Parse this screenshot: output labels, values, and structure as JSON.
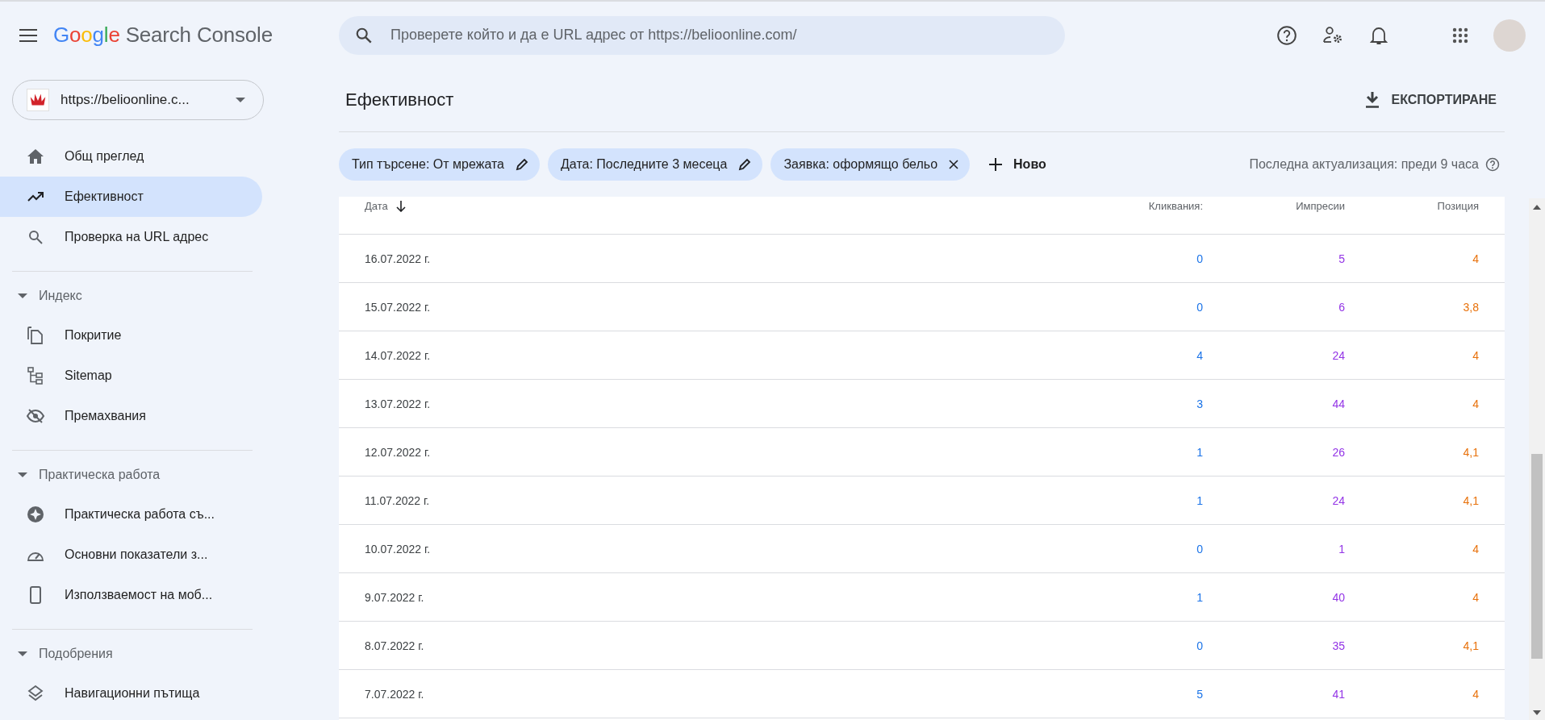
{
  "header": {
    "logo_google": "Google",
    "logo_product": "Search Console",
    "search": {
      "placeholder": "Проверете който и да е URL адрес от https://belioonline.com/"
    }
  },
  "sidebar": {
    "property": "https://belioonline.c...",
    "groups": [
      {
        "items": [
          {
            "label": "Общ преглед",
            "selected": false
          },
          {
            "label": "Ефективност",
            "selected": true
          },
          {
            "label": "Проверка на URL адрес",
            "selected": false
          }
        ]
      },
      {
        "title": "Индекс",
        "expanded": true,
        "items": [
          {
            "label": "Покритие",
            "selected": false
          },
          {
            "label": "Sitemap",
            "selected": false
          },
          {
            "label": "Премахвания",
            "selected": false
          }
        ]
      },
      {
        "title": "Практическа работа",
        "expanded": true,
        "items": [
          {
            "label": "Практическа работа съ...",
            "selected": false
          },
          {
            "label": "Основни показатели з...",
            "selected": false
          },
          {
            "label": "Използваемост на моб...",
            "selected": false
          }
        ]
      },
      {
        "title": "Подобрения",
        "expanded": true,
        "items": [
          {
            "label": "Навигационни пътища",
            "selected": false
          }
        ]
      }
    ]
  },
  "page": {
    "title": "Ефективност",
    "export": "ЕКСПОРТИРАНЕ",
    "filters": [
      {
        "label": "Тип търсене: От мрежата",
        "kind": "edit"
      },
      {
        "label": "Дата: Последните 3 месеца",
        "kind": "edit"
      },
      {
        "label": "Заявка: оформящо бельо",
        "kind": "remove"
      }
    ],
    "new_filter": "Ново",
    "last_update": "Последна актуализация: преди 9 часа"
  },
  "table": {
    "columns": [
      {
        "label": "Дата",
        "sorted": true
      },
      {
        "label": "Кликвания:",
        "sorted": false
      },
      {
        "label": "Импресии",
        "sorted": false
      },
      {
        "label": "Позиция",
        "sorted": false
      }
    ],
    "rows": [
      [
        "16.07.2022 г.",
        "0",
        "5",
        "4"
      ],
      [
        "15.07.2022 г.",
        "0",
        "6",
        "3,8"
      ],
      [
        "14.07.2022 г.",
        "4",
        "24",
        "4"
      ],
      [
        "13.07.2022 г.",
        "3",
        "44",
        "4"
      ],
      [
        "12.07.2022 г.",
        "1",
        "26",
        "4,1"
      ],
      [
        "11.07.2022 г.",
        "1",
        "24",
        "4,1"
      ],
      [
        "10.07.2022 г.",
        "0",
        "1",
        "4"
      ],
      [
        "9.07.2022 г.",
        "1",
        "40",
        "4"
      ],
      [
        "8.07.2022 г.",
        "0",
        "35",
        "4,1"
      ],
      [
        "7.07.2022 г.",
        "5",
        "41",
        "4"
      ]
    ]
  }
}
